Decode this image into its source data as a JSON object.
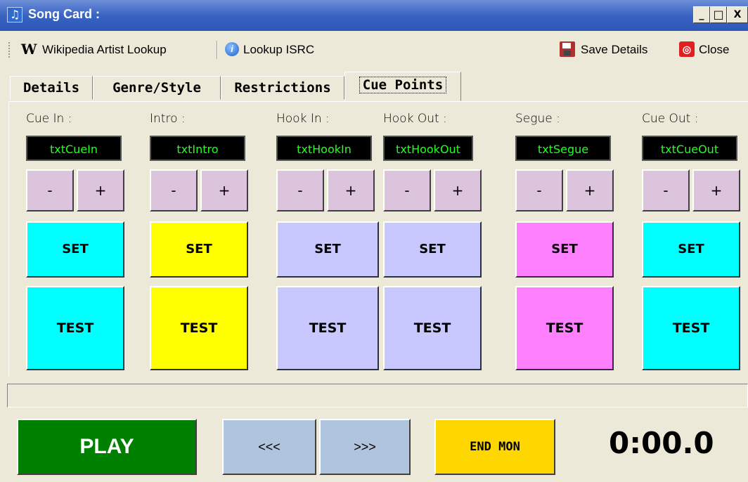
{
  "window": {
    "title": "Song Card :",
    "minimize_label": "_",
    "maximize_label": "□",
    "close_label": "X"
  },
  "toolbar": {
    "wikipedia_label": "Wikipedia Artist Lookup",
    "isrc_label": "Lookup ISRC",
    "save_label": "Save Details",
    "close_label": "Close",
    "info_glyph": "i"
  },
  "tabs": [
    {
      "label": "Details"
    },
    {
      "label": "Genre/Style"
    },
    {
      "label": "Restrictions"
    },
    {
      "label": "Cue Points",
      "active": true
    }
  ],
  "cue_points": [
    {
      "label": "Cue In :",
      "field": "txtCueIn",
      "set_label": "SET",
      "test_label": "TEST",
      "color": "#00ffff"
    },
    {
      "label": "Intro :",
      "field": "txtIntro",
      "set_label": "SET",
      "test_label": "TEST",
      "color": "#ffff00"
    },
    {
      "label": "Hook In :",
      "field": "txtHookIn",
      "set_label": "SET",
      "test_label": "TEST",
      "color": "#c8c8ff"
    },
    {
      "label": "Hook Out :",
      "field": "txtHookOut",
      "set_label": "SET",
      "test_label": "TEST",
      "color": "#c8c8ff"
    },
    {
      "label": "Segue :",
      "field": "txtSegue",
      "set_label": "SET",
      "test_label": "TEST",
      "color": "#ff80ff"
    },
    {
      "label": "Cue Out :",
      "field": "txtCueOut",
      "set_label": "SET",
      "test_label": "TEST",
      "color": "#00ffff"
    }
  ],
  "adjust": {
    "minus": "-",
    "plus": "+"
  },
  "status_text": "",
  "transport": {
    "play_label": "PLAY",
    "rewind_label": "<<<",
    "forward_label": ">>>",
    "end_mon_label": "END MON",
    "time": "0:00.0"
  }
}
